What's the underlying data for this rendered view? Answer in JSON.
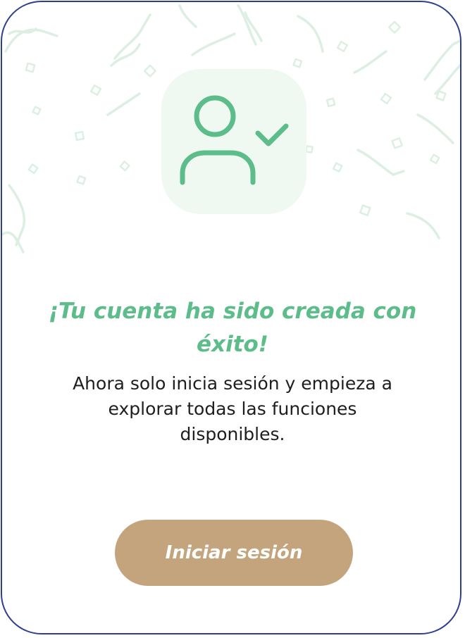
{
  "colors": {
    "accent_green": "#5cbd8a",
    "icon_bg": "#f0f8f2",
    "button_bg": "#c4a47c",
    "border": "#2f3f8f",
    "confetti": "#dcefe2"
  },
  "icon": {
    "name": "user-check-icon"
  },
  "title": "¡Tu cuenta ha sido creada con éxito!",
  "subtitle": "Ahora solo inicia sesión y empieza a explorar todas las funciones disponibles.",
  "cta": {
    "label": "Iniciar sesión"
  }
}
